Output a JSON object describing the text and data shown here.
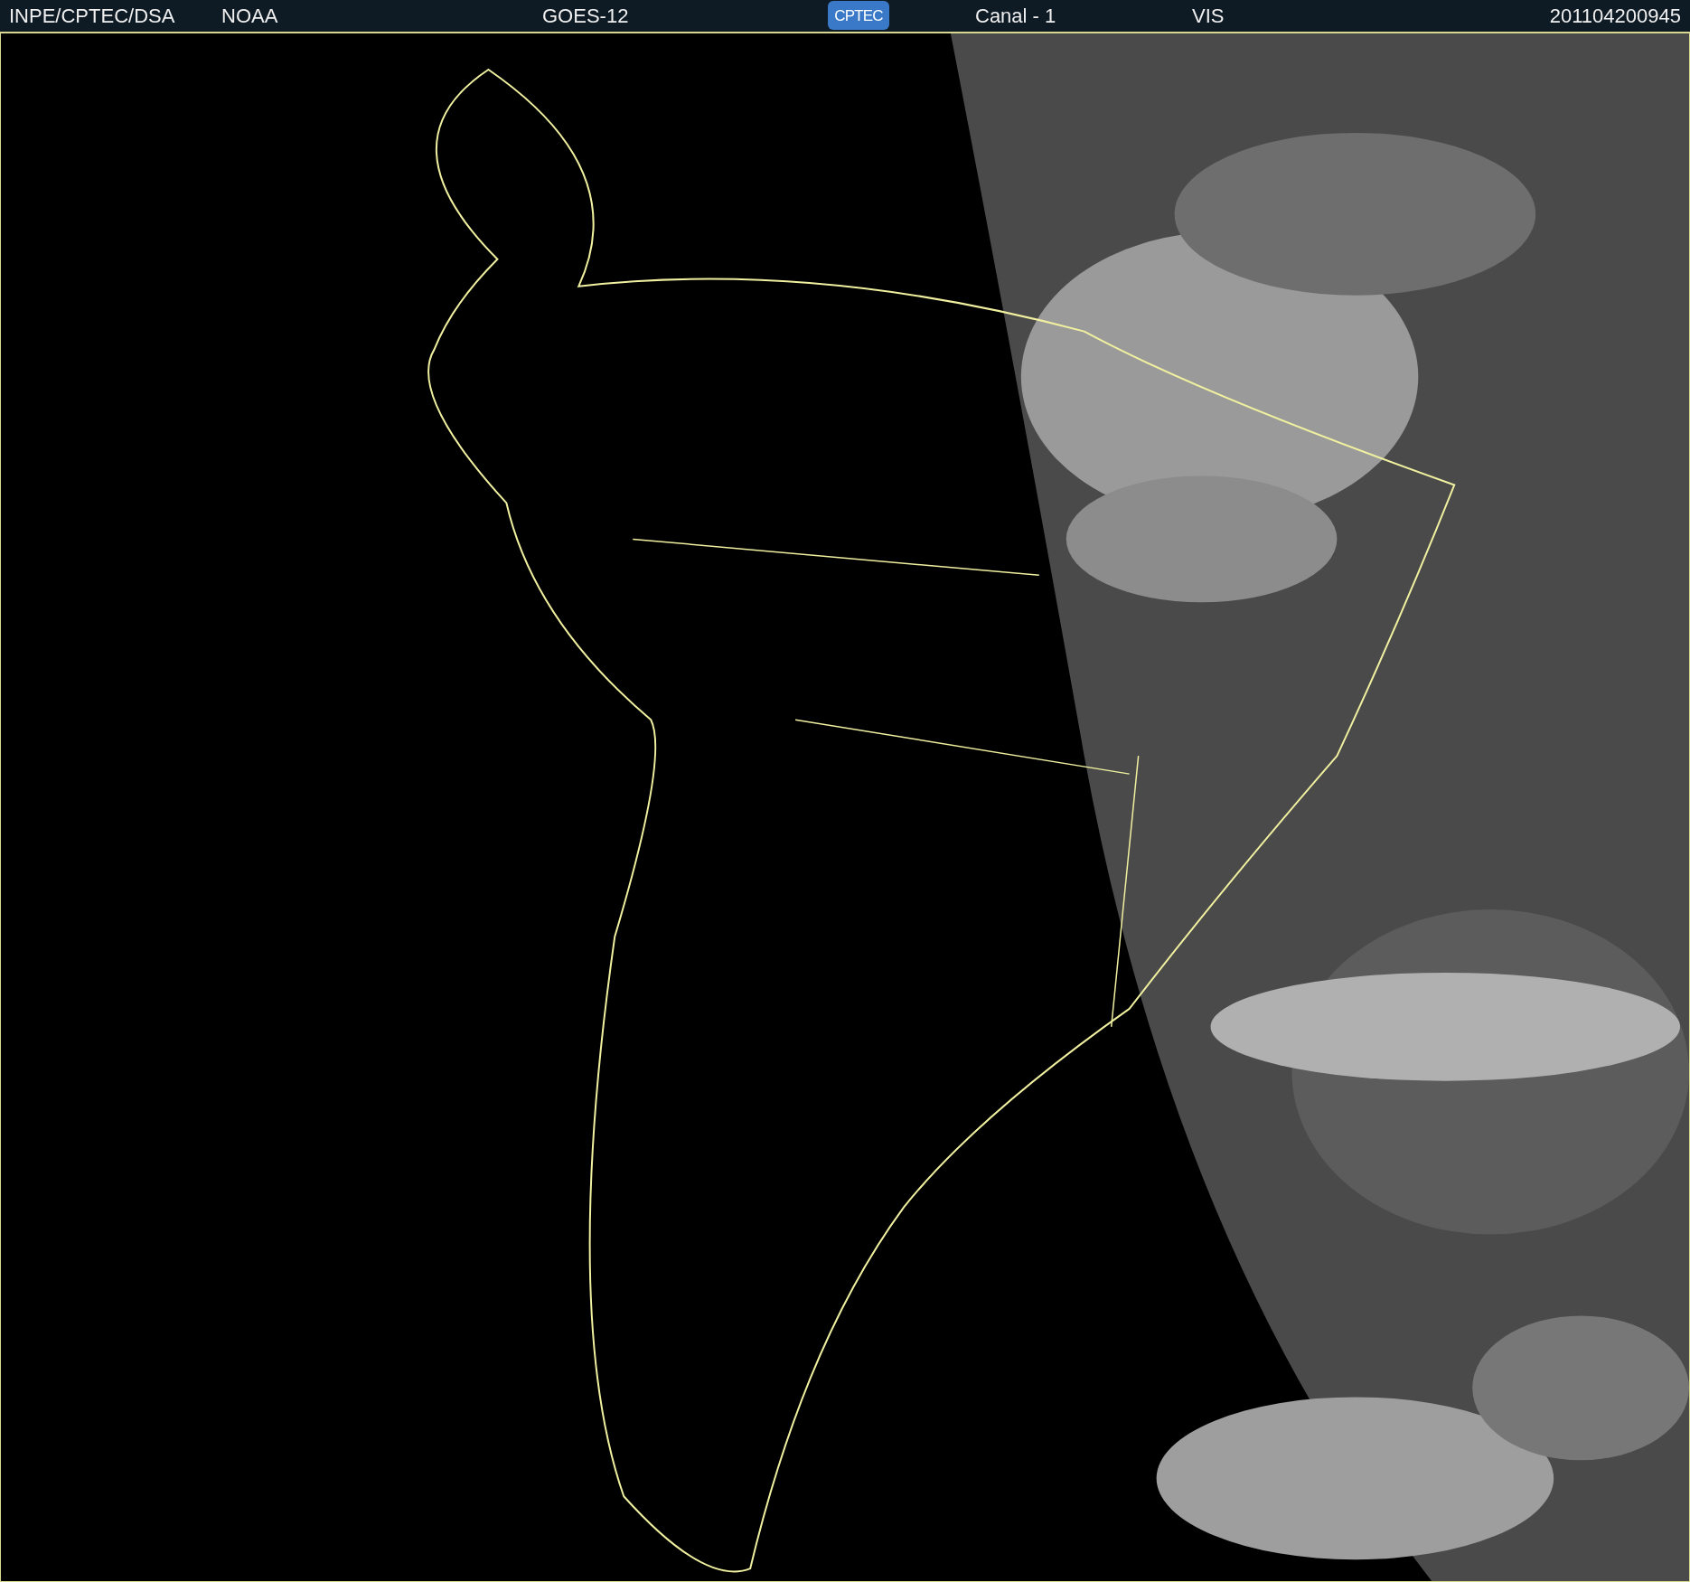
{
  "header": {
    "source": "INPE/CPTEC/DSA",
    "agency": "NOAA",
    "satellite": "GOES-12",
    "logo": "CPTEC",
    "channel": "Canal - 1",
    "band": "VIS",
    "timestamp": "201104200945"
  }
}
